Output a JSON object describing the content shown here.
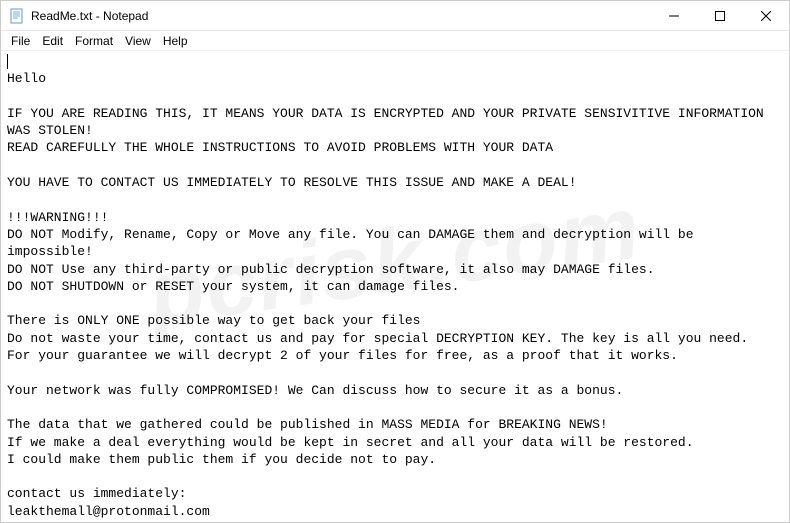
{
  "titlebar": {
    "title": "ReadMe.txt - Notepad"
  },
  "menubar": {
    "file": "File",
    "edit": "Edit",
    "format": "Format",
    "view": "View",
    "help": "Help"
  },
  "content": {
    "body": "Hello\n\nIF YOU ARE READING THIS, IT MEANS YOUR DATA IS ENCRYPTED AND YOUR PRIVATE SENSIVITIVE INFORMATION WAS STOLEN!\nREAD CAREFULLY THE WHOLE INSTRUCTIONS TO AVOID PROBLEMS WITH YOUR DATA\n\nYOU HAVE TO CONTACT US IMMEDIATELY TO RESOLVE THIS ISSUE AND MAKE A DEAL!\n\n!!!WARNING!!!\nDO NOT Modify, Rename, Copy or Move any file. You can DAMAGE them and decryption will be impossible!\nDO NOT Use any third-party or public decryption software, it also may DAMAGE files.\nDO NOT SHUTDOWN or RESET your system, it can damage files.\n\nThere is ONLY ONE possible way to get back your files\nDo not waste your time, contact us and pay for special DECRYPTION KEY. The key is all you need.\nFor your guarantee we will decrypt 2 of your files for free, as a proof that it works.\n\nYour network was fully COMPROMISED! We Can discuss how to secure it as a bonus.\n\nThe data that we gathered could be published in MASS MEDIA for BREAKING NEWS!\nIf we make a deal everything would be kept in secret and all your data will be restored.\nI could make them public them if you decide not to pay.\n\ncontact us immediately:\nleakthemall@protonmail.com"
  },
  "watermark": {
    "text": "pcrisk.com"
  }
}
